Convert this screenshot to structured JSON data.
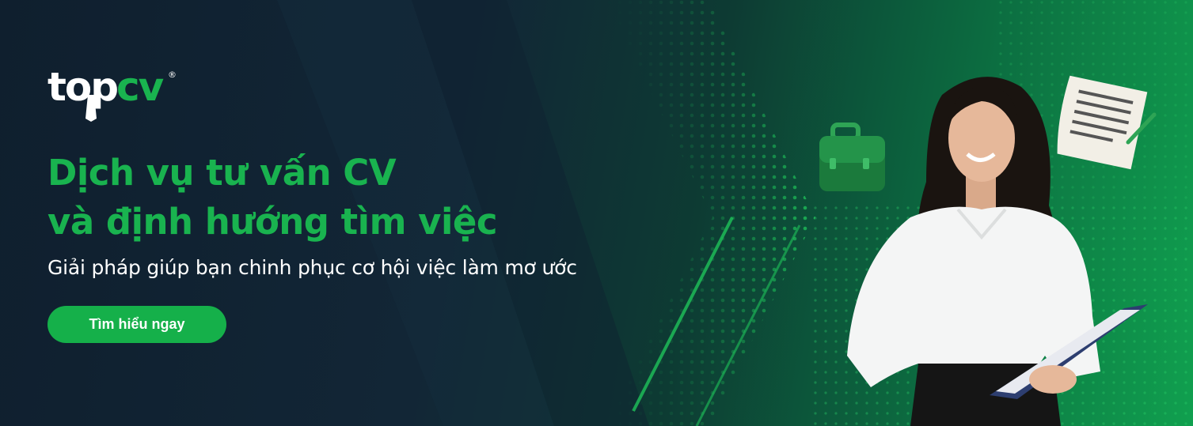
{
  "brand": {
    "logo_text_top": "top",
    "logo_text_cv": "cv",
    "logo_mark": "®",
    "logo_color": "#ffffff",
    "accent_color": "#19b34f"
  },
  "banner": {
    "headline_line1": "Dịch vụ tư vấn CV",
    "headline_line2": "và định hướng tìm việc",
    "subtitle": "Giải pháp giúp bạn chinh phục cơ hội việc làm mơ ước",
    "cta_label": "Tìm hiểu ngay"
  },
  "illustration": {
    "icons": [
      "briefcase-icon",
      "document-icon",
      "pen-icon",
      "clipboard-icon"
    ]
  }
}
